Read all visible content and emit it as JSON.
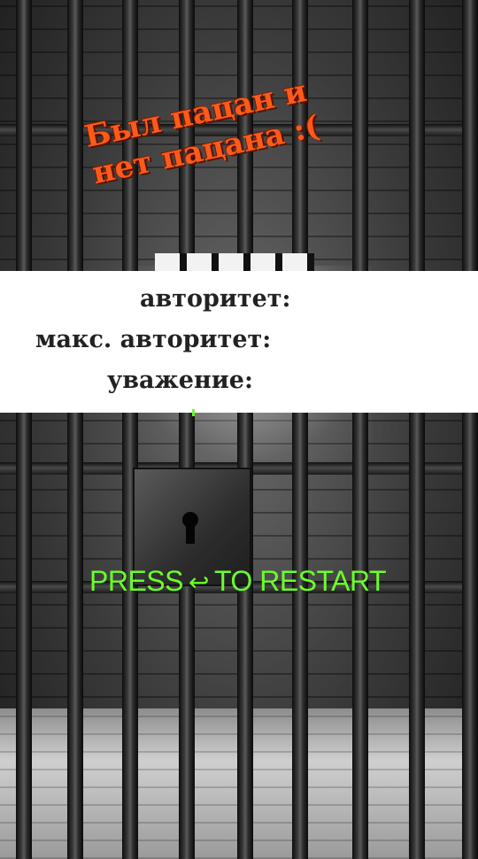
{
  "headline": {
    "line1": "Был пацан и",
    "line2": "нет пацана :("
  },
  "stats": {
    "authority": "авторитет:",
    "max_authority": "макс. авторитет:",
    "respect": "уважение:"
  },
  "restart": {
    "press": "PRESS",
    "arrow": "↩",
    "to_restart": "TO RESTART"
  },
  "colors": {
    "headline": "#ff5a1a",
    "restart": "#6bff2a"
  },
  "icons": {
    "enter_key": "return-arrow-icon",
    "keyhole": "keyhole-icon"
  }
}
